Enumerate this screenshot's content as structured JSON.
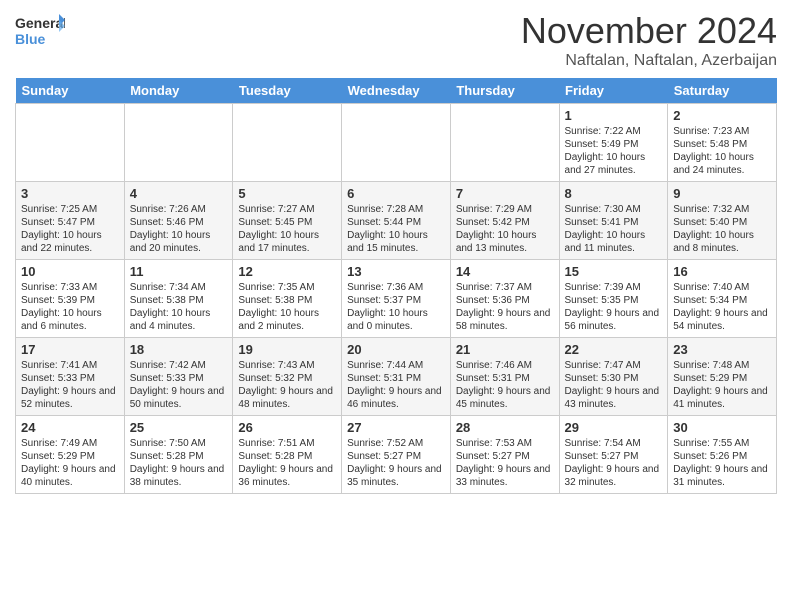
{
  "header": {
    "logo_general": "General",
    "logo_blue": "Blue",
    "month_title": "November 2024",
    "location": "Naftalan, Naftalan, Azerbaijan"
  },
  "days_of_week": [
    "Sunday",
    "Monday",
    "Tuesday",
    "Wednesday",
    "Thursday",
    "Friday",
    "Saturday"
  ],
  "weeks": [
    [
      {
        "day": "",
        "info": ""
      },
      {
        "day": "",
        "info": ""
      },
      {
        "day": "",
        "info": ""
      },
      {
        "day": "",
        "info": ""
      },
      {
        "day": "",
        "info": ""
      },
      {
        "day": "1",
        "info": "Sunrise: 7:22 AM\nSunset: 5:49 PM\nDaylight: 10 hours and 27 minutes."
      },
      {
        "day": "2",
        "info": "Sunrise: 7:23 AM\nSunset: 5:48 PM\nDaylight: 10 hours and 24 minutes."
      }
    ],
    [
      {
        "day": "3",
        "info": "Sunrise: 7:25 AM\nSunset: 5:47 PM\nDaylight: 10 hours and 22 minutes."
      },
      {
        "day": "4",
        "info": "Sunrise: 7:26 AM\nSunset: 5:46 PM\nDaylight: 10 hours and 20 minutes."
      },
      {
        "day": "5",
        "info": "Sunrise: 7:27 AM\nSunset: 5:45 PM\nDaylight: 10 hours and 17 minutes."
      },
      {
        "day": "6",
        "info": "Sunrise: 7:28 AM\nSunset: 5:44 PM\nDaylight: 10 hours and 15 minutes."
      },
      {
        "day": "7",
        "info": "Sunrise: 7:29 AM\nSunset: 5:42 PM\nDaylight: 10 hours and 13 minutes."
      },
      {
        "day": "8",
        "info": "Sunrise: 7:30 AM\nSunset: 5:41 PM\nDaylight: 10 hours and 11 minutes."
      },
      {
        "day": "9",
        "info": "Sunrise: 7:32 AM\nSunset: 5:40 PM\nDaylight: 10 hours and 8 minutes."
      }
    ],
    [
      {
        "day": "10",
        "info": "Sunrise: 7:33 AM\nSunset: 5:39 PM\nDaylight: 10 hours and 6 minutes."
      },
      {
        "day": "11",
        "info": "Sunrise: 7:34 AM\nSunset: 5:38 PM\nDaylight: 10 hours and 4 minutes."
      },
      {
        "day": "12",
        "info": "Sunrise: 7:35 AM\nSunset: 5:38 PM\nDaylight: 10 hours and 2 minutes."
      },
      {
        "day": "13",
        "info": "Sunrise: 7:36 AM\nSunset: 5:37 PM\nDaylight: 10 hours and 0 minutes."
      },
      {
        "day": "14",
        "info": "Sunrise: 7:37 AM\nSunset: 5:36 PM\nDaylight: 9 hours and 58 minutes."
      },
      {
        "day": "15",
        "info": "Sunrise: 7:39 AM\nSunset: 5:35 PM\nDaylight: 9 hours and 56 minutes."
      },
      {
        "day": "16",
        "info": "Sunrise: 7:40 AM\nSunset: 5:34 PM\nDaylight: 9 hours and 54 minutes."
      }
    ],
    [
      {
        "day": "17",
        "info": "Sunrise: 7:41 AM\nSunset: 5:33 PM\nDaylight: 9 hours and 52 minutes."
      },
      {
        "day": "18",
        "info": "Sunrise: 7:42 AM\nSunset: 5:33 PM\nDaylight: 9 hours and 50 minutes."
      },
      {
        "day": "19",
        "info": "Sunrise: 7:43 AM\nSunset: 5:32 PM\nDaylight: 9 hours and 48 minutes."
      },
      {
        "day": "20",
        "info": "Sunrise: 7:44 AM\nSunset: 5:31 PM\nDaylight: 9 hours and 46 minutes."
      },
      {
        "day": "21",
        "info": "Sunrise: 7:46 AM\nSunset: 5:31 PM\nDaylight: 9 hours and 45 minutes."
      },
      {
        "day": "22",
        "info": "Sunrise: 7:47 AM\nSunset: 5:30 PM\nDaylight: 9 hours and 43 minutes."
      },
      {
        "day": "23",
        "info": "Sunrise: 7:48 AM\nSunset: 5:29 PM\nDaylight: 9 hours and 41 minutes."
      }
    ],
    [
      {
        "day": "24",
        "info": "Sunrise: 7:49 AM\nSunset: 5:29 PM\nDaylight: 9 hours and 40 minutes."
      },
      {
        "day": "25",
        "info": "Sunrise: 7:50 AM\nSunset: 5:28 PM\nDaylight: 9 hours and 38 minutes."
      },
      {
        "day": "26",
        "info": "Sunrise: 7:51 AM\nSunset: 5:28 PM\nDaylight: 9 hours and 36 minutes."
      },
      {
        "day": "27",
        "info": "Sunrise: 7:52 AM\nSunset: 5:27 PM\nDaylight: 9 hours and 35 minutes."
      },
      {
        "day": "28",
        "info": "Sunrise: 7:53 AM\nSunset: 5:27 PM\nDaylight: 9 hours and 33 minutes."
      },
      {
        "day": "29",
        "info": "Sunrise: 7:54 AM\nSunset: 5:27 PM\nDaylight: 9 hours and 32 minutes."
      },
      {
        "day": "30",
        "info": "Sunrise: 7:55 AM\nSunset: 5:26 PM\nDaylight: 9 hours and 31 minutes."
      }
    ]
  ]
}
